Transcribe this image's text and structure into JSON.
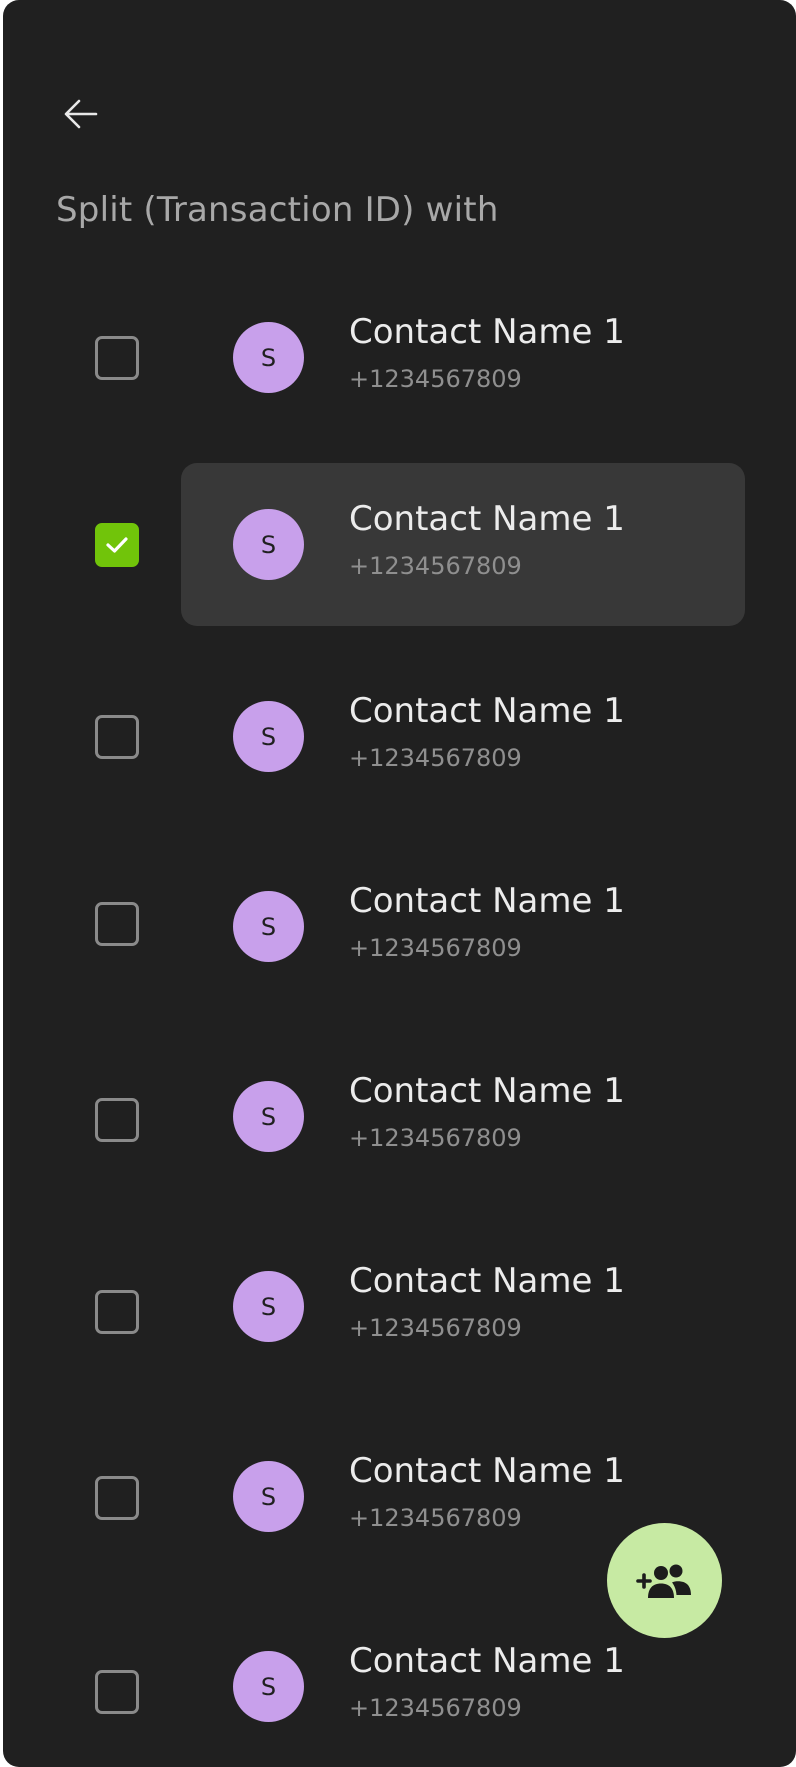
{
  "header": {
    "back_icon": "arrow-left-icon",
    "title": "Split (Transaction ID) with"
  },
  "contacts": [
    {
      "initial": "S",
      "name": "Contact Name 1",
      "phone": "+1234567809",
      "checked": false
    },
    {
      "initial": "S",
      "name": "Contact Name 1",
      "phone": "+1234567809",
      "checked": true
    },
    {
      "initial": "S",
      "name": "Contact Name 1",
      "phone": "+1234567809",
      "checked": false
    },
    {
      "initial": "S",
      "name": "Contact Name 1",
      "phone": "+1234567809",
      "checked": false
    },
    {
      "initial": "S",
      "name": "Contact Name 1",
      "phone": "+1234567809",
      "checked": false
    },
    {
      "initial": "S",
      "name": "Contact Name 1",
      "phone": "+1234567809",
      "checked": false
    },
    {
      "initial": "S",
      "name": "Contact Name 1",
      "phone": "+1234567809",
      "checked": false
    },
    {
      "initial": "S",
      "name": "Contact Name 1",
      "phone": "+1234567809",
      "checked": false
    }
  ],
  "fab": {
    "icon": "add-group-icon"
  },
  "colors": {
    "background": "#202020",
    "highlight": "#383838",
    "checkbox_checked": "#71c40a",
    "avatar": "#c8a0eb",
    "fab": "#c7eaa3"
  }
}
